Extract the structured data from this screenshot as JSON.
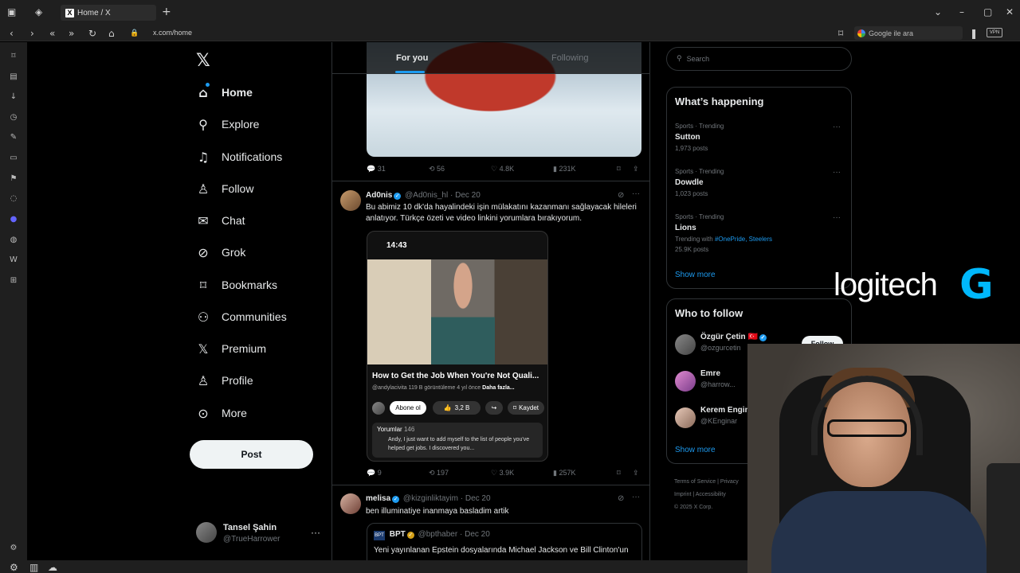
{
  "browser": {
    "tab_title": "Home / X",
    "url": "x.com/home",
    "search_placeholder": "Google ile ara",
    "vpn_label": "VPN"
  },
  "sidebar": {
    "items": [
      {
        "label": "Home",
        "icon": "home-icon"
      },
      {
        "label": "Explore",
        "icon": "search-icon"
      },
      {
        "label": "Notifications",
        "icon": "bell-icon"
      },
      {
        "label": "Follow",
        "icon": "person-add-icon"
      },
      {
        "label": "Chat",
        "icon": "mail-icon"
      },
      {
        "label": "Grok",
        "icon": "grok-icon"
      },
      {
        "label": "Bookmarks",
        "icon": "bookmark-icon"
      },
      {
        "label": "Communities",
        "icon": "people-icon"
      },
      {
        "label": "Premium",
        "icon": "x-icon"
      },
      {
        "label": "Profile",
        "icon": "person-icon"
      },
      {
        "label": "More",
        "icon": "more-circle-icon"
      }
    ],
    "post_label": "Post",
    "profile": {
      "name": "Tansel Şahin",
      "handle": "@TrueHarrower"
    }
  },
  "feed": {
    "tabs": [
      "For you",
      "Following"
    ],
    "first_post_stats": {
      "replies": "31",
      "reposts": "56",
      "likes": "4.8K",
      "views": "231K"
    },
    "tweet1": {
      "name": "Ad0nis",
      "handle": "@Ad0nis_hl",
      "date": "· Dec 20",
      "text": "Bu abimiz 10 dk'da hayalindeki işin mülakatını kazanmanı sağlayacak hileleri anlatıyor. Türkçe özeti ve video linkini yorumlara bırakıyorum.",
      "card": {
        "time": "14:43",
        "title": "How to Get the Job When You're Not Quali...",
        "channel": "@andylacivita",
        "views": "119 B görüntüleme",
        "ago": "4 yıl önce",
        "more": "Daha fazla...",
        "subscribe": "Abone ol",
        "likes": "3,2 B",
        "save": "Kaydet",
        "comments_label": "Yorumlar",
        "comments_count": "146",
        "comment_text": "Andy, I just want to add myself to the list of people you've helped get jobs. I discovered you..."
      },
      "stats": {
        "replies": "9",
        "reposts": "197",
        "likes": "3.9K",
        "views": "257K"
      }
    },
    "tweet2": {
      "name": "melisa",
      "handle": "@kizginliktayim",
      "date": "· Dec 20",
      "text": "ben illuminatiye inanmaya basladim artik",
      "quote": {
        "name": "BPT",
        "handle": "@bpthaber",
        "date": "· Dec 20",
        "text": "Yeni yayınlanan Epstein dosyalarında Michael Jackson ve Bill Clinton'un"
      }
    }
  },
  "right": {
    "search_placeholder": "Search",
    "happening_title": "What’s happening",
    "trends": [
      {
        "category": "Sports · Trending",
        "name": "Sutton",
        "posts": "1,973 posts"
      },
      {
        "category": "Sports · Trending",
        "name": "Dowdle",
        "posts": "1,023 posts"
      },
      {
        "category": "Sports · Trending",
        "name": "Lions",
        "with_prefix": "Trending with",
        "tags": "#OnePride, Steelers",
        "posts": "25.9K posts"
      }
    ],
    "show_more": "Show more",
    "who_to_follow_title": "Who to follow",
    "follow": [
      {
        "name": "Özgür Çetin 🇹🇷",
        "handle": "@ozgurcetin"
      },
      {
        "name": "Emre",
        "handle": "@harrow..."
      },
      {
        "name": "Kerem Engin",
        "handle": "@KEnginar"
      }
    ],
    "follow_button": "Follow",
    "footer": [
      "Terms of Service",
      "Privacy",
      "Imprint",
      "Accessibility",
      "© 2025 X Corp."
    ]
  },
  "overlay": {
    "logo_text": "logitech",
    "logo_mark": "G"
  }
}
